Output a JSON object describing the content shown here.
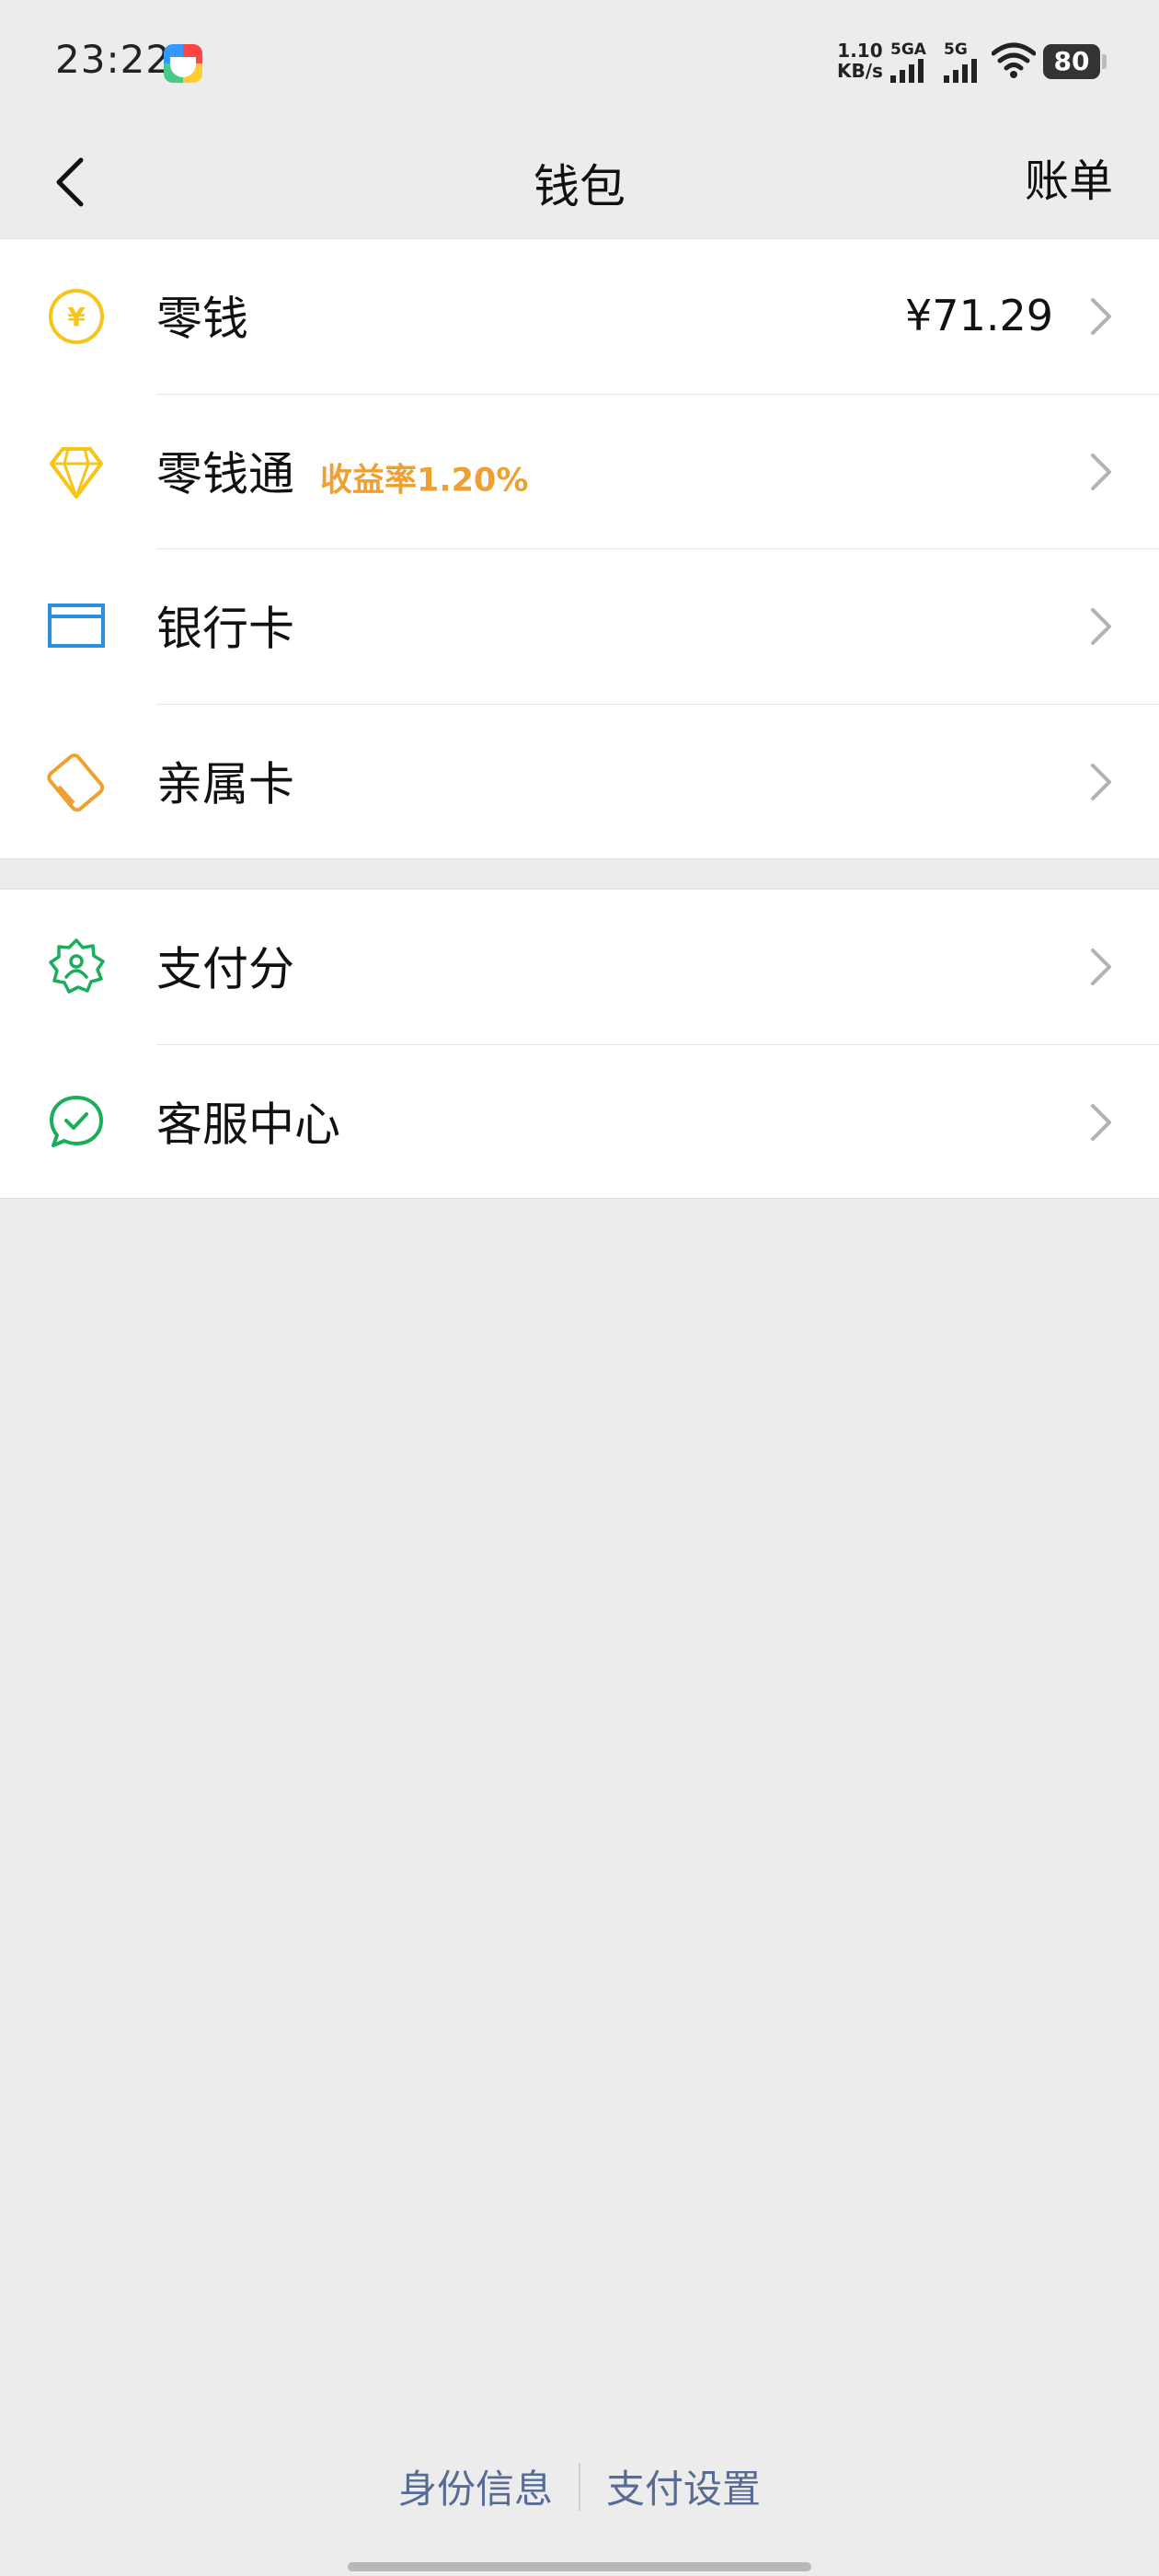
{
  "status_bar": {
    "time": "23:22",
    "net_speed_value": "1.10",
    "net_speed_unit": "KB/s",
    "signal_1_label": "5GA",
    "signal_2_label": "5G",
    "battery": "80"
  },
  "nav": {
    "title": "钱包",
    "action_label": "账单"
  },
  "group1": [
    {
      "label": "零钱",
      "value": "¥71.29",
      "icon": "yuan-coin-icon",
      "color": "#f5c518"
    },
    {
      "label": "零钱通",
      "badge": "收益率1.20%",
      "icon": "diamond-icon",
      "color": "#f5c518"
    },
    {
      "label": "银行卡",
      "icon": "bank-card-icon",
      "color": "#2b8fe0"
    },
    {
      "label": "亲属卡",
      "icon": "family-card-icon",
      "color": "#f0a030"
    }
  ],
  "group2": [
    {
      "label": "支付分",
      "icon": "payscore-badge-icon",
      "color": "#1aad5a"
    },
    {
      "label": "客服中心",
      "icon": "customer-service-icon",
      "color": "#1aad5a"
    }
  ],
  "footer": {
    "identity_label": "身份信息",
    "settings_label": "支付设置",
    "link_color": "#576b95"
  }
}
